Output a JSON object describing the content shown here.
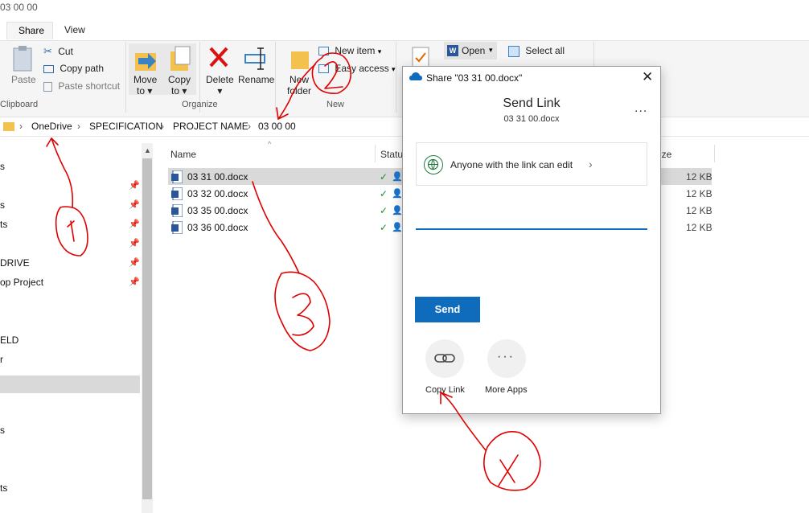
{
  "window": {
    "title": "03 00 00"
  },
  "tabs": [
    "Share",
    "View"
  ],
  "ribbon": {
    "clipboard": {
      "paste": "Paste",
      "cut": "Cut",
      "copy_path": "Copy path",
      "paste_shortcut": "Paste shortcut",
      "group": "Clipboard"
    },
    "organize": {
      "move_to": "Move",
      "move_to_sub": "to",
      "copy_to": "Copy",
      "copy_to_sub": "to",
      "delete": "Delete",
      "rename": "Rename",
      "group": "Organize"
    },
    "new": {
      "new_folder": "New",
      "new_folder_sub": "folder",
      "new_item": "New item",
      "easy_access": "Easy access",
      "group": "New"
    },
    "open": {
      "open": "Open",
      "select_all": "Select all"
    }
  },
  "breadcrumb": [
    "OneDrive",
    "SPECIFICATION",
    "PROJECT NAME",
    "03 00 00"
  ],
  "nav": {
    "items": [
      {
        "label": "s"
      },
      {
        "label": "s"
      },
      {
        "label": "ts"
      },
      {
        "label": "DRIVE"
      },
      {
        "label": "op Project"
      },
      {
        "label": "ELD"
      },
      {
        "label": "r"
      },
      {
        "label": "s"
      },
      {
        "label": "ts"
      }
    ]
  },
  "columns": {
    "name": "Name",
    "status": "Status",
    "size": "ize"
  },
  "files": [
    {
      "name": "03 31 00.docx",
      "size": "12 KB"
    },
    {
      "name": "03 32 00.docx",
      "size": "12 KB"
    },
    {
      "name": "03 35 00.docx",
      "size": "12 KB"
    },
    {
      "name": "03 36 00.docx",
      "size": "12 KB"
    }
  ],
  "share_dialog": {
    "title": "Share \"03 31 00.docx\"",
    "heading": "Send Link",
    "subheading": "03 31 00.docx",
    "permission": "Anyone with the link can edit",
    "send": "Send",
    "copy_link": "Copy Link",
    "more_apps": "More Apps",
    "more_menu": "...",
    "accent_color": "#0f6cbd"
  },
  "annotations": {
    "color": "#e00000",
    "labels": [
      "1",
      "2",
      "3",
      "4"
    ]
  }
}
